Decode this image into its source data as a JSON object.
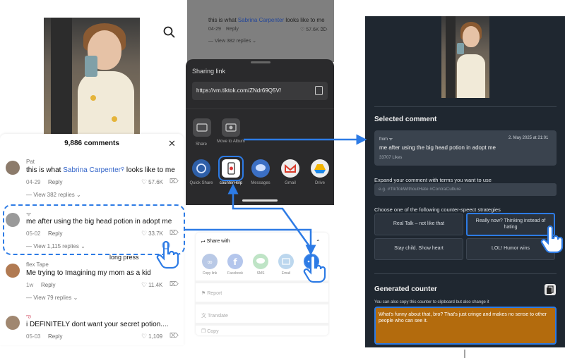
{
  "colors": {
    "accent": "#2d7be5",
    "counter_bg": "#1f2730",
    "counter_output": "#b36b0d",
    "tiktok_link": "#3062c8"
  },
  "comments_sheet": {
    "title": "9,886 comments",
    "close_icon": "close-icon",
    "comments": [
      {
        "author": "Pat",
        "text_before": "this is what ",
        "text_link": "Sabrina Carpenter",
        "text_after": " looks like to me",
        "date": "04-29",
        "reply": "Reply",
        "likes": "57.6K",
        "views": "View 382 replies"
      },
      {
        "author": "ᯤ",
        "text": "me after using the big head potion in adopt me",
        "date": "05-02",
        "reply": "Reply",
        "likes": "33.7K",
        "views": "View 1,115 replies"
      },
      {
        "author": "flex Tape",
        "text": "Me trying to Imagining my mom as a kid",
        "date": "1w",
        "reply": "Reply",
        "likes": "11.4K",
        "views": "View 79 replies"
      },
      {
        "author": "ఌ",
        "text": "i DEFINITELY dont want your secret potion....",
        "date": "05-03",
        "reply": "Reply",
        "likes": "1,109"
      }
    ],
    "long_press_label": "long press"
  },
  "share_background": {
    "text_before": "this is what ",
    "text_link": "Sabrina Carpenter",
    "text_after": " looks like to me",
    "date": "04-29",
    "reply": "Reply",
    "likes": "57.6K",
    "views": "View 382 replies"
  },
  "share_sheet": {
    "title": "Sharing link",
    "link": "https://vm.tiktok.com/ZNdr69Q5V/",
    "row1": [
      {
        "label": "Share",
        "icon": "folder-icon"
      },
      {
        "label": "Move to Album",
        "icon": "album-icon"
      }
    ],
    "row2": [
      {
        "label": "Quick Share",
        "icon": "quick-share-icon"
      },
      {
        "label": "counterHelp",
        "icon": "counterhelp-app-icon"
      },
      {
        "label": "Messages",
        "icon": "messages-icon"
      },
      {
        "label": "Gmail",
        "icon": "gmail-icon"
      },
      {
        "label": "Drive",
        "icon": "drive-icon"
      }
    ]
  },
  "share_with": {
    "title": "Share with",
    "apps": [
      {
        "label": "Copy link",
        "icon": "link-icon",
        "color": "#b9c9e6"
      },
      {
        "label": "Facebook",
        "icon": "facebook-icon",
        "color": "#b4c6ec"
      },
      {
        "label": "SMS",
        "icon": "sms-icon",
        "color": "#bfe4c6"
      },
      {
        "label": "Email",
        "icon": "email-icon",
        "color": "#bcd7ee"
      },
      {
        "label": "More",
        "icon": "more-icon",
        "color": "#2d7be5"
      }
    ],
    "rows": [
      "Report",
      "Translate",
      "Copy"
    ]
  },
  "counter_help": {
    "selected_heading": "Selected comment",
    "from_label": "from ᯤ",
    "date": "2. May 2025 at 21:01",
    "comment": "me after using the big head potion in adopt me",
    "likes": "33707 Likes",
    "expand_label": "Expand your comment with terms you want to use",
    "expand_placeholder": "e.g. #TikTokWithoutHate #ContraCulture",
    "strategy_label": "Choose one of the following counter-speect strategies",
    "strategies": [
      "Real Talk – not like that",
      "Really now? Thinking instead of hating",
      "Stay child. Show heart",
      "LOL! Humor wins"
    ],
    "generated_heading": "Generated counter",
    "generated_hint": "You can also copy this counter to clipboard but also change it",
    "generated_text": "What's funny about that, bro? That's just cringe and makes no sense to other people who can see it."
  }
}
